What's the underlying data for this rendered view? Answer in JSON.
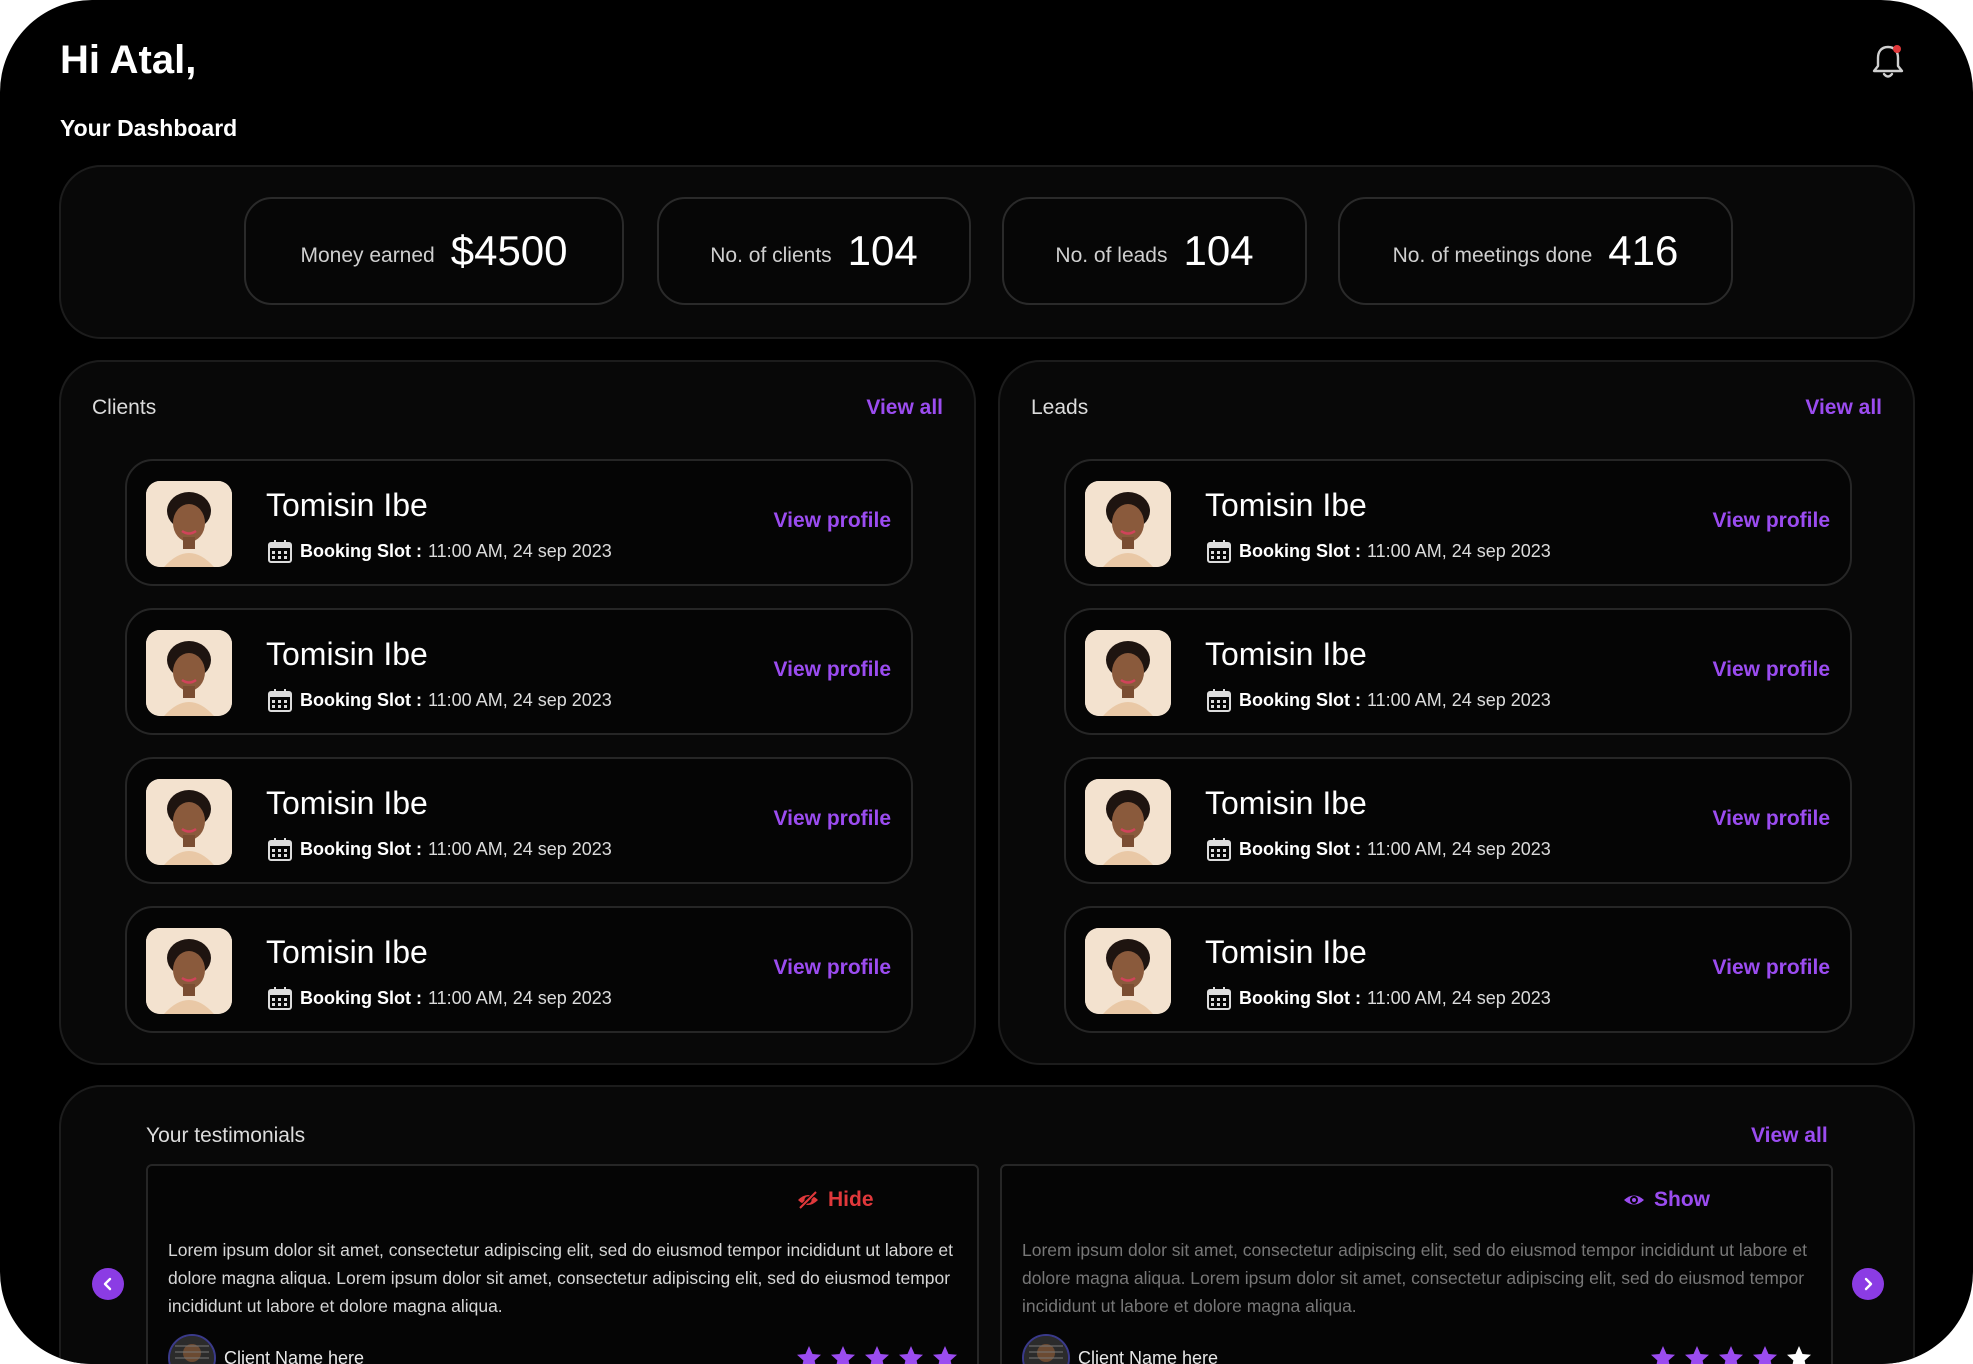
{
  "header": {
    "greeting": "Hi Atal,",
    "subtitle": "Your Dashboard"
  },
  "stats": [
    {
      "label": "Money earned",
      "value": "$4500"
    },
    {
      "label": "No. of clients",
      "value": "104"
    },
    {
      "label": "No. of leads",
      "value": "104"
    },
    {
      "label": "No. of meetings done",
      "value": "416"
    }
  ],
  "clients": {
    "title": "Clients",
    "view_all": "View all",
    "items": [
      {
        "name": "Tomisin Ibe",
        "slot_label": "Booking Slot :",
        "slot_value": "11:00 AM, 24 sep 2023",
        "action": "View profile"
      },
      {
        "name": "Tomisin Ibe",
        "slot_label": "Booking Slot :",
        "slot_value": "11:00 AM, 24 sep 2023",
        "action": "View profile"
      },
      {
        "name": "Tomisin Ibe",
        "slot_label": "Booking Slot :",
        "slot_value": "11:00 AM, 24 sep 2023",
        "action": "View profile"
      },
      {
        "name": "Tomisin Ibe",
        "slot_label": "Booking Slot :",
        "slot_value": "11:00 AM, 24 sep 2023",
        "action": "View profile"
      }
    ]
  },
  "leads": {
    "title": "Leads",
    "view_all": "View all",
    "items": [
      {
        "name": "Tomisin Ibe",
        "slot_label": "Booking Slot :",
        "slot_value": "11:00 AM, 24 sep 2023",
        "action": "View profile"
      },
      {
        "name": "Tomisin Ibe",
        "slot_label": "Booking Slot :",
        "slot_value": "11:00 AM, 24 sep 2023",
        "action": "View profile"
      },
      {
        "name": "Tomisin Ibe",
        "slot_label": "Booking Slot :",
        "slot_value": "11:00 AM, 24 sep 2023",
        "action": "View profile"
      },
      {
        "name": "Tomisin Ibe",
        "slot_label": "Booking Slot :",
        "slot_value": "11:00 AM, 24 sep 2023",
        "action": "View profile"
      }
    ]
  },
  "testimonials": {
    "title": "Your testimonials",
    "view_all": "View all",
    "cards": [
      {
        "toggle_label": "Hide",
        "toggle_icon": "eye-slash-icon",
        "toggle_color": "#e0383b",
        "text": "Lorem ipsum dolor sit amet, consectetur adipiscing elit, sed do eiusmod tempor incididunt ut labore et dolore magna aliqua. Lorem ipsum dolor sit amet, consectetur adipiscing elit, sed do eiusmod tempor incididunt ut labore et dolore magna aliqua.",
        "client_name": "Client Name here",
        "rating": 5
      },
      {
        "toggle_label": "Show",
        "toggle_icon": "eye-icon",
        "toggle_color": "#9b4cf0",
        "text": "Lorem ipsum dolor sit amet, consectetur adipiscing elit, sed do eiusmod tempor incididunt ut labore et dolore magna aliqua. Lorem ipsum dolor sit amet, consectetur adipiscing elit, sed do eiusmod tempor incididunt ut labore et dolore magna aliqua.",
        "client_name": "Client Name here",
        "rating": 4
      }
    ]
  },
  "colors": {
    "accent": "#9b4cf0",
    "hide": "#e0383b",
    "background": "#000000",
    "panel": "#080808",
    "star_empty": "#ffffff"
  },
  "icons": {
    "notification": "bell-icon",
    "calendar": "calendar-icon",
    "prev": "chevron-left-icon",
    "next": "chevron-right-icon",
    "star": "star-icon"
  }
}
